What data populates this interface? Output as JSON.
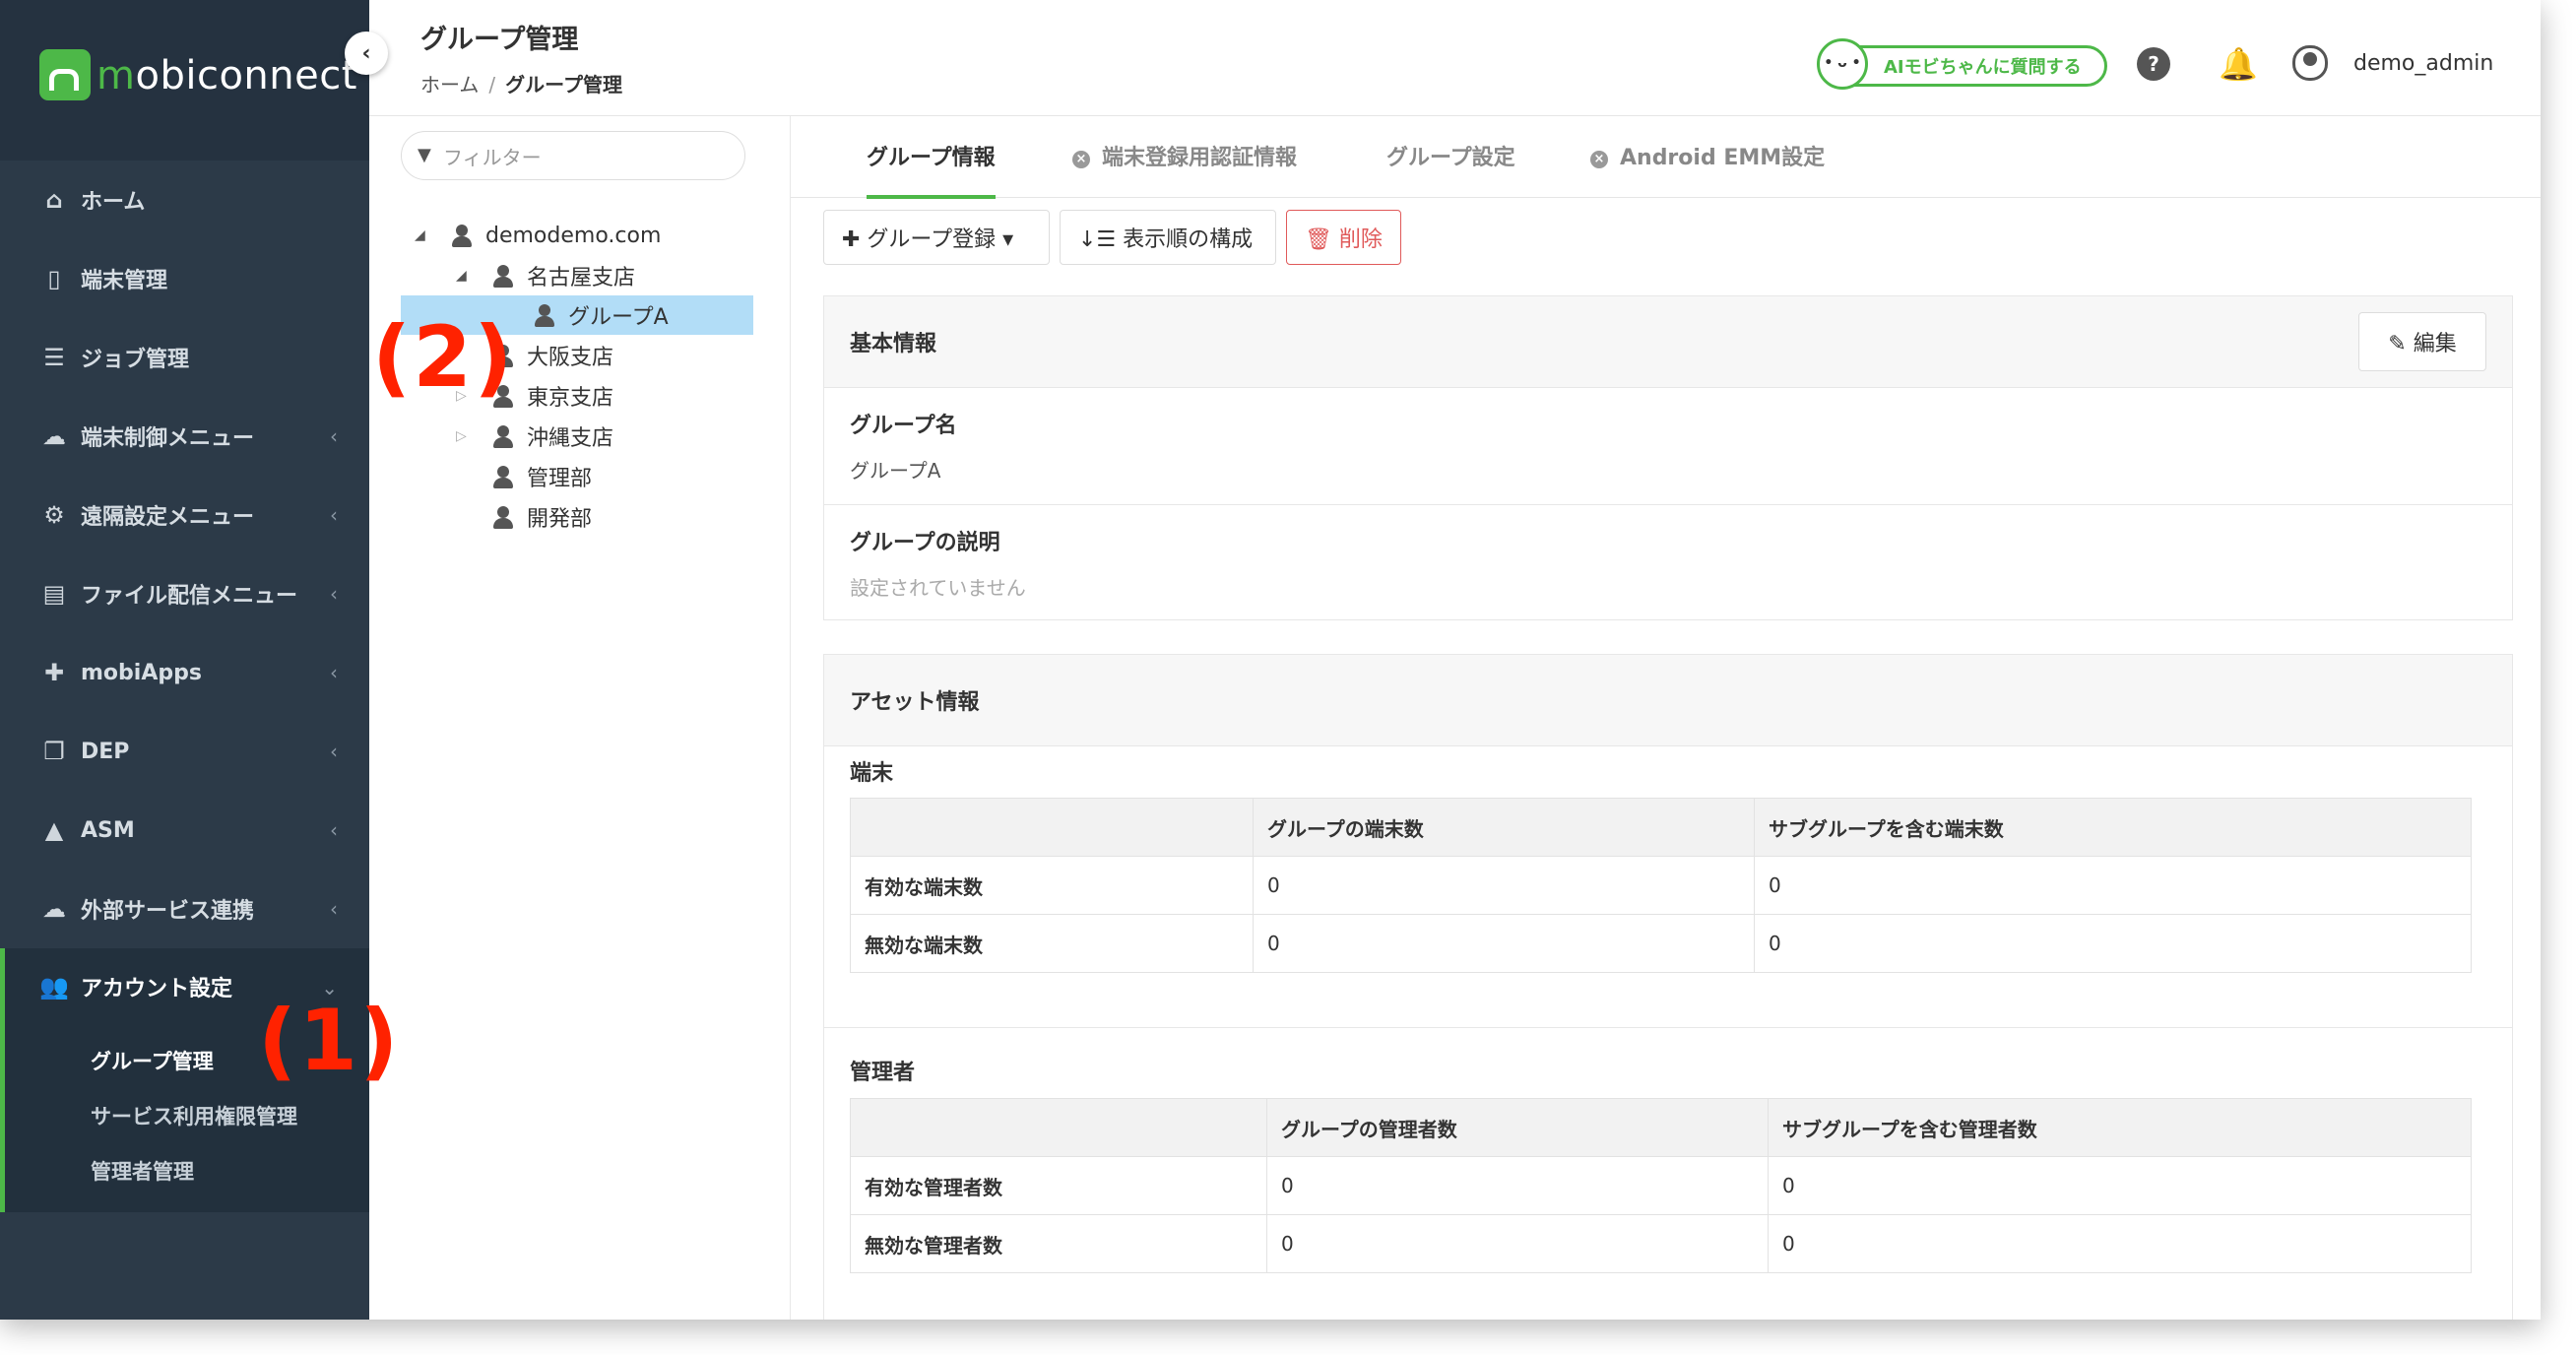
{
  "brand": {
    "logo_text_m": "m",
    "logo_text_rest": "obiconnect",
    "collapse_icon": "‹"
  },
  "nav": [
    {
      "label": "ホーム",
      "icon": "home-icon",
      "glyph": "⌂",
      "chev": ""
    },
    {
      "label": "端末管理",
      "icon": "device-icon",
      "glyph": "▯",
      "chev": ""
    },
    {
      "label": "ジョブ管理",
      "icon": "job-icon",
      "glyph": "☰",
      "chev": ""
    },
    {
      "label": "端末制御メニュー",
      "icon": "cloud-icon",
      "glyph": "☁",
      "chev": "‹"
    },
    {
      "label": "遠隔設定メニュー",
      "icon": "gears-icon",
      "glyph": "⚙",
      "chev": "‹"
    },
    {
      "label": "ファイル配信メニュー",
      "icon": "file-icon",
      "glyph": "▤",
      "chev": "‹"
    },
    {
      "label": "mobiApps",
      "icon": "puzzle-icon",
      "glyph": "✚",
      "chev": "‹"
    },
    {
      "label": "DEP",
      "icon": "copy-icon",
      "glyph": "❐",
      "chev": "‹"
    },
    {
      "label": "ASM",
      "icon": "graduation-cap-icon",
      "glyph": "▲",
      "chev": "‹"
    },
    {
      "label": "外部サービス連携",
      "icon": "cloud-link-icon",
      "glyph": "☁",
      "chev": "‹"
    }
  ],
  "nav_open": {
    "label": "アカウント設定",
    "icon": "users-icon",
    "glyph": "👥",
    "chev": "⌄"
  },
  "subnav": [
    "グループ管理",
    "サービス利用権限管理",
    "管理者管理"
  ],
  "header": {
    "title": "グループ管理",
    "breadcrumb_home": "ホーム",
    "breadcrumb_sep": "/",
    "breadcrumb_current": "グループ管理",
    "ai_button": "AIモビちゃんに質問する",
    "ai_face": "• ᴗ •",
    "help_glyph": "?",
    "bell_glyph": "🔔",
    "username": "demo_admin"
  },
  "tree": {
    "filter_placeholder": "フィルター",
    "filter_glyph": "▼",
    "root": "demodemo.com",
    "nodes": {
      "nagoya": "名古屋支店",
      "groupA": "グループA",
      "osaka": "大阪支店",
      "tokyo": "東京支店",
      "okinawa": "沖縄支店",
      "kanri": "管理部",
      "kaihatsu": "開発部"
    },
    "open_glyph": "◢",
    "closed_glyph": "▷"
  },
  "tabs": [
    "グループ情報",
    "端末登録用認証情報",
    "グループ設定",
    "Android EMM設定"
  ],
  "tab_x": "×",
  "toolbar": {
    "register": "✚ グループ登録 ▾",
    "reorder": "↓☰ 表示順の構成",
    "delete": "🗑 削除"
  },
  "basic": {
    "title": "基本情報",
    "edit": "✎ 編集",
    "name_label": "グループ名",
    "name_value": "グループA",
    "desc_label": "グループの説明",
    "desc_value": "設定されていません"
  },
  "asset": {
    "title": "アセット情報",
    "devices_label": "端末",
    "devices_headers": [
      "",
      "グループの端末数",
      "サブグループを含む端末数"
    ],
    "devices_rows": [
      [
        "有効な端末数",
        "0",
        "0"
      ],
      [
        "無効な端末数",
        "0",
        "0"
      ]
    ],
    "admins_label": "管理者",
    "admins_headers": [
      "",
      "グループの管理者数",
      "サブグループを含む管理者数"
    ],
    "admins_rows": [
      [
        "有効な管理者数",
        "0",
        "0"
      ],
      [
        "無効な管理者数",
        "0",
        "0"
      ]
    ]
  },
  "annotations": {
    "a1": "(1)",
    "a2": "(2)"
  },
  "colors": {
    "sidebar": "#2c3a48",
    "accent": "#4db848",
    "danger": "#e05a5a",
    "selected": "#b2ddf7",
    "annotation": "#ff2200"
  }
}
